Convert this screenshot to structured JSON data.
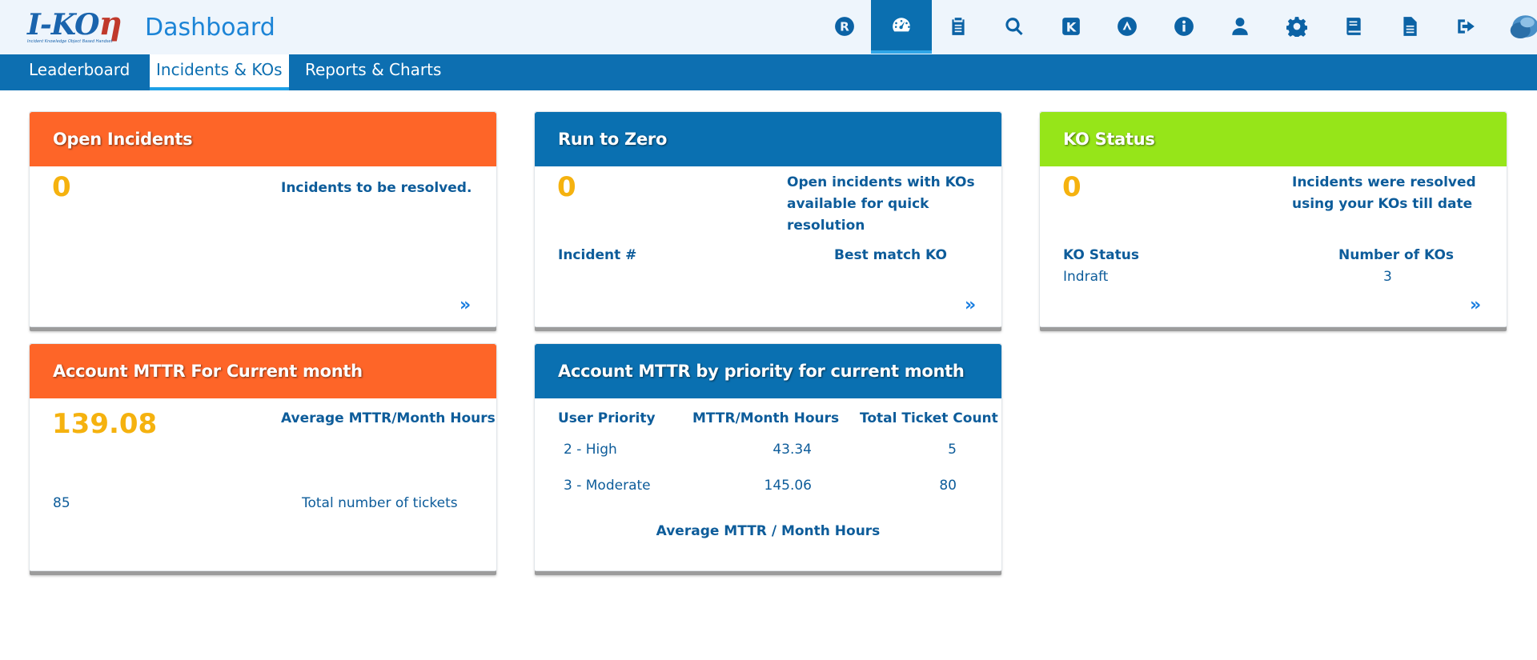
{
  "header": {
    "logo_text": "I-KO",
    "logo_suffix": "η",
    "logo_tagline": "Incident Knowledge Object Based Handset",
    "title": "Dashboard",
    "icons": [
      "r-badge-icon",
      "dashboard-gauge-icon",
      "clipboard-icon",
      "search-icon",
      "k-badge-icon",
      "a-badge-icon",
      "info-icon",
      "user-icon",
      "gear-icon",
      "book-icon",
      "document-icon",
      "logout-icon",
      "profile-image-icon"
    ]
  },
  "tabs": [
    {
      "label": "Leaderboard"
    },
    {
      "label": "Incidents & KOs"
    },
    {
      "label": "Reports & Charts"
    }
  ],
  "open_incidents": {
    "title": "Open Incidents",
    "count": "0",
    "label": "Incidents to be resolved.",
    "more": "»"
  },
  "run_to_zero": {
    "title": "Run to Zero",
    "count": "0",
    "label_line1": "Open incidents with KOs",
    "label_line2": "available for quick resolution",
    "col1": "Incident #",
    "col2": "Best match KO",
    "more": "»"
  },
  "ko_status": {
    "title": "KO Status",
    "count": "0",
    "label_line1": "Incidents were resolved",
    "label_line2": "using your KOs till date",
    "col1": "KO Status",
    "col2": "Number of KOs",
    "row_status": "Indraft",
    "row_count": "3",
    "more": "»"
  },
  "mttr_month": {
    "title": "Account MTTR For Current month",
    "value": "139.08",
    "value_label": "Average MTTR/Month Hours",
    "tickets": "85",
    "tickets_label": "Total number of tickets"
  },
  "mttr_priority": {
    "title": "Account MTTR by priority for current month",
    "headers": [
      "User Priority",
      "MTTR/Month Hours",
      "Total Ticket Count"
    ],
    "rows": [
      {
        "priority": "2 - High",
        "mttr": "43.34",
        "count": "5"
      },
      {
        "priority": "3 - Moderate",
        "mttr": "145.06",
        "count": "80"
      }
    ],
    "footer": "Average MTTR / Month Hours"
  },
  "colors": {
    "orange": "#fe6528",
    "blue": "#0a70b1",
    "green": "#96e519",
    "accent_number": "#f5b20f"
  }
}
